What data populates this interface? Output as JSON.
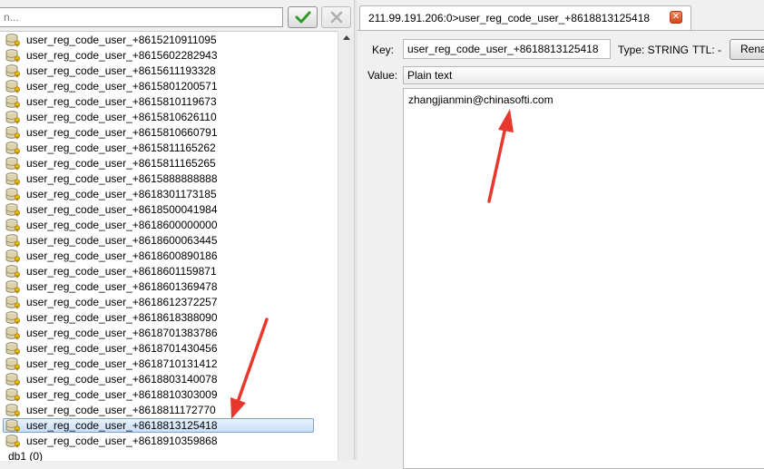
{
  "filter": {
    "placeholder": "n..."
  },
  "keys": [
    "user_reg_code_user_+8615210911095",
    "user_reg_code_user_+8615602282943",
    "user_reg_code_user_+8615611193328",
    "user_reg_code_user_+8615801200571",
    "user_reg_code_user_+8615810119673",
    "user_reg_code_user_+8615810626110",
    "user_reg_code_user_+8615810660791",
    "user_reg_code_user_+8615811165262",
    "user_reg_code_user_+8615811165265",
    "user_reg_code_user_+8615888888888",
    "user_reg_code_user_+8618301173185",
    "user_reg_code_user_+8618500041984",
    "user_reg_code_user_+8618600000000",
    "user_reg_code_user_+8618600063445",
    "user_reg_code_user_+8618600890186",
    "user_reg_code_user_+8618601159871",
    "user_reg_code_user_+8618601369478",
    "user_reg_code_user_+8618612372257",
    "user_reg_code_user_+8618618388090",
    "user_reg_code_user_+8618701383786",
    "user_reg_code_user_+8618701430456",
    "user_reg_code_user_+8618710131412",
    "user_reg_code_user_+8618803140078",
    "user_reg_code_user_+8618810303009",
    "user_reg_code_user_+8618811172770",
    "user_reg_code_user_+8618813125418",
    "user_reg_code_user_+8618910359868"
  ],
  "selected_index": 25,
  "db_next": "db1 (0)",
  "tab": {
    "title": "211.99.191.206:0>user_reg_code_user_+8618813125418"
  },
  "editor": {
    "key_label": "Key:",
    "key_value": "user_reg_code_user_+8618813125418",
    "type_label": "Type: STRING",
    "ttl_label": "TTL: -",
    "rename_label": "Rename",
    "value_label": "Value:",
    "format": "Plain text",
    "value_text": "zhangjianmin@chinasofti.com"
  },
  "colors": {
    "accent_selection": "#c7def7",
    "annotation_arrow": "#e8382e"
  }
}
